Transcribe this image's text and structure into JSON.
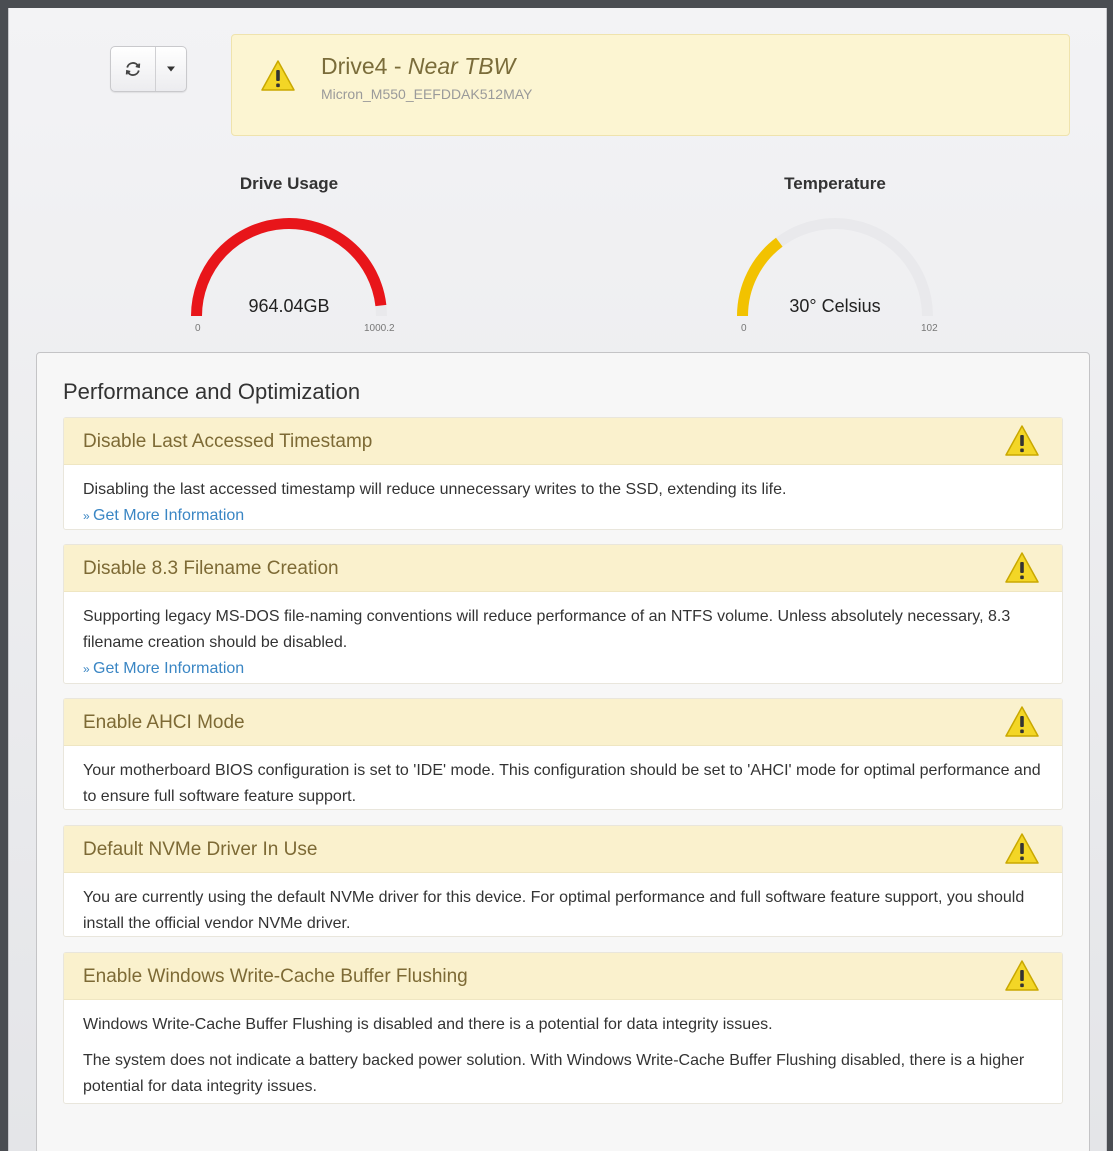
{
  "toolbar": {
    "refresh_icon": "refresh-icon",
    "caret_icon": "caret-down-icon"
  },
  "drive": {
    "name": "Drive4",
    "separator": " - ",
    "status": "Near TBW",
    "model": "Micron_M550_EEFDDAK512MAY",
    "status_color": "#fcf5d2"
  },
  "gauges": {
    "usage": {
      "title": "Drive Usage",
      "value_label": "964.04GB",
      "min": "0",
      "max": "1000.2",
      "value": 964.04,
      "range": [
        0,
        1000.2
      ],
      "color": "#e8151a"
    },
    "temperature": {
      "title": "Temperature",
      "value_label": "30° Celsius",
      "min": "0",
      "max": "102",
      "value": 30,
      "range": [
        0,
        102
      ],
      "color": "#f2c200"
    }
  },
  "performance": {
    "title": "Performance and Optimization",
    "more_info_label": "Get More Information",
    "items": [
      {
        "title": "Disable Last Accessed Timestamp",
        "paragraphs": [
          "Disabling the last accessed timestamp will reduce unnecessary writes to the SSD, extending its life."
        ],
        "link": "Get More Information"
      },
      {
        "title": "Disable 8.3 Filename Creation",
        "paragraphs": [
          "Supporting legacy MS-DOS file-naming conventions will reduce performance of an NTFS volume. Unless absolutely necessary, 8.3 filename creation should be disabled."
        ],
        "link": "Get More Information"
      },
      {
        "title": "Enable AHCI Mode",
        "paragraphs": [
          "Your motherboard BIOS configuration is set to 'IDE' mode. This configuration should be set to 'AHCI' mode for optimal performance and to ensure full software feature support."
        ]
      },
      {
        "title": "Default NVMe Driver In Use",
        "paragraphs": [
          "You are currently using the default NVMe driver for this device. For optimal performance and full software feature support, you should install the official vendor NVMe driver."
        ]
      },
      {
        "title": "Enable Windows Write-Cache Buffer Flushing",
        "paragraphs": [
          "Windows Write-Cache Buffer Flushing is disabled and there is a potential for data integrity issues.",
          "The system does not indicate a battery backed power solution. With Windows Write-Cache Buffer Flushing disabled, there is a higher potential for data integrity issues."
        ]
      }
    ]
  }
}
